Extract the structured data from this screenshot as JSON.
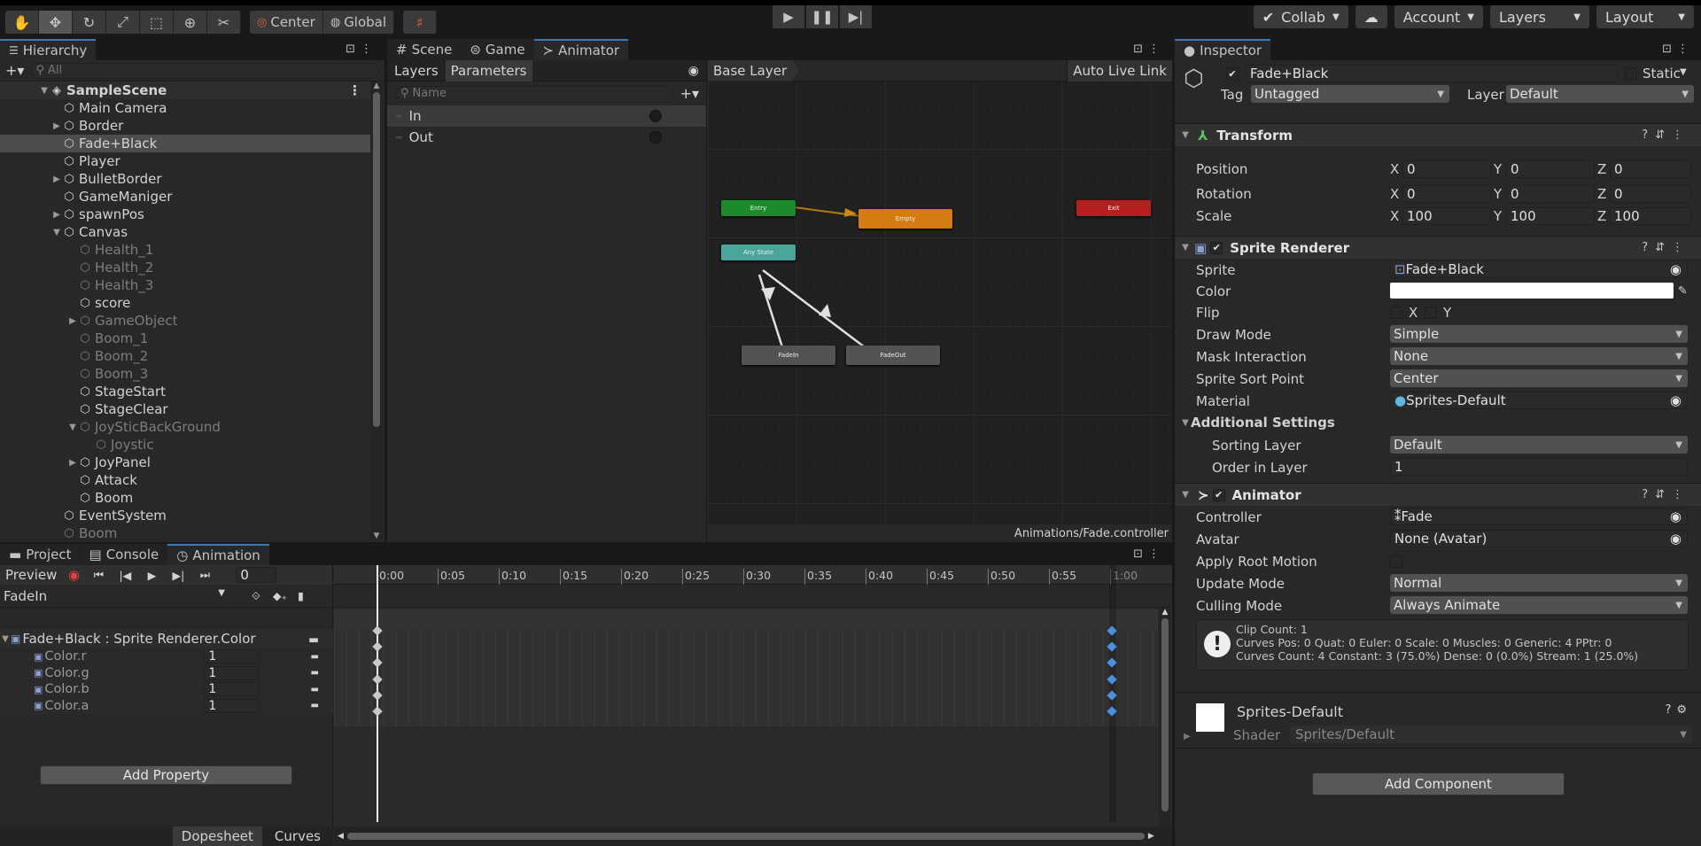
{
  "toolbar": {
    "center": "Center",
    "global": "Global",
    "collab": "Collab",
    "account": "Account",
    "layers": "Layers",
    "layout": "Layout"
  },
  "hierarchy": {
    "tab": "Hierarchy",
    "search_placeholder": "All",
    "scene": "SampleScene",
    "items": [
      {
        "name": "Main Camera",
        "indent": 1,
        "arrow": "",
        "dim": false,
        "sel": false
      },
      {
        "name": "Border",
        "indent": 1,
        "arrow": "▶",
        "dim": false,
        "sel": false
      },
      {
        "name": "Fade+Black",
        "indent": 1,
        "arrow": "",
        "dim": false,
        "sel": true
      },
      {
        "name": "Player",
        "indent": 1,
        "arrow": "",
        "dim": false,
        "sel": false
      },
      {
        "name": "BulletBorder",
        "indent": 1,
        "arrow": "▶",
        "dim": false,
        "sel": false
      },
      {
        "name": "GameManiger",
        "indent": 1,
        "arrow": "",
        "dim": false,
        "sel": false
      },
      {
        "name": "spawnPos",
        "indent": 1,
        "arrow": "▶",
        "dim": false,
        "sel": false
      },
      {
        "name": "Canvas",
        "indent": 1,
        "arrow": "▼",
        "dim": false,
        "sel": false
      },
      {
        "name": "Health_1",
        "indent": 2,
        "arrow": "",
        "dim": true,
        "sel": false
      },
      {
        "name": "Health_2",
        "indent": 2,
        "arrow": "",
        "dim": true,
        "sel": false
      },
      {
        "name": "Health_3",
        "indent": 2,
        "arrow": "",
        "dim": true,
        "sel": false
      },
      {
        "name": "score",
        "indent": 2,
        "arrow": "",
        "dim": false,
        "sel": false
      },
      {
        "name": "GameObject",
        "indent": 2,
        "arrow": "▶",
        "dim": true,
        "sel": false
      },
      {
        "name": "Boom_1",
        "indent": 2,
        "arrow": "",
        "dim": true,
        "sel": false
      },
      {
        "name": "Boom_2",
        "indent": 2,
        "arrow": "",
        "dim": true,
        "sel": false
      },
      {
        "name": "Boom_3",
        "indent": 2,
        "arrow": "",
        "dim": true,
        "sel": false
      },
      {
        "name": "StageStart",
        "indent": 2,
        "arrow": "",
        "dim": false,
        "sel": false
      },
      {
        "name": "StageClear",
        "indent": 2,
        "arrow": "",
        "dim": false,
        "sel": false
      },
      {
        "name": "JoySticBackGround",
        "indent": 2,
        "arrow": "▼",
        "dim": true,
        "sel": false
      },
      {
        "name": "Joystic",
        "indent": 3,
        "arrow": "",
        "dim": true,
        "sel": false
      },
      {
        "name": "JoyPanel",
        "indent": 2,
        "arrow": "▶",
        "dim": false,
        "sel": false
      },
      {
        "name": "Attack",
        "indent": 2,
        "arrow": "",
        "dim": false,
        "sel": false
      },
      {
        "name": "Boom",
        "indent": 2,
        "arrow": "",
        "dim": false,
        "sel": false
      },
      {
        "name": "EventSystem",
        "indent": 1,
        "arrow": "",
        "dim": false,
        "sel": false
      },
      {
        "name": "Boom",
        "indent": 1,
        "arrow": "",
        "dim": true,
        "sel": false
      }
    ]
  },
  "center_tabs": {
    "scene": "Scene",
    "game": "Game",
    "animator": "Animator"
  },
  "animator": {
    "layers_tab": "Layers",
    "params_tab": "Parameters",
    "name_placeholder": "Name",
    "params": [
      "In",
      "Out"
    ],
    "breadcrumb": "Base Layer",
    "auto_live_link": "Auto Live Link",
    "footer": "Animations/Fade.controller",
    "nodes": {
      "entry": "Entry",
      "empty": "Empty",
      "exit": "Exit",
      "any_state": "Any State",
      "fadein": "FadeIn",
      "fadeout": "FadeOut"
    }
  },
  "bottom_tabs": {
    "project": "Project",
    "console": "Console",
    "animation": "Animation"
  },
  "animation": {
    "preview": "Preview",
    "frame": "0",
    "clip": "FadeIn",
    "ticks": [
      "0:00",
      "0:05",
      "0:10",
      "0:15",
      "0:20",
      "0:25",
      "0:30",
      "0:35",
      "0:40",
      "0:45",
      "0:50",
      "0:55",
      "1:00"
    ],
    "group": "Fade+Black : Sprite Renderer.Color",
    "props": [
      {
        "name": "Color.r",
        "value": "1"
      },
      {
        "name": "Color.g",
        "value": "1"
      },
      {
        "name": "Color.b",
        "value": "1"
      },
      {
        "name": "Color.a",
        "value": "1"
      }
    ],
    "add_property": "Add Property",
    "dopesheet": "Dopesheet",
    "curves": "Curves"
  },
  "inspector": {
    "tab": "Inspector",
    "object_name": "Fade+Black",
    "static": "Static",
    "tag_label": "Tag",
    "tag": "Untagged",
    "layer_label": "Layer",
    "layer": "Default",
    "transform": {
      "title": "Transform",
      "position": "Position",
      "rotation": "Rotation",
      "scale": "Scale",
      "x": "X",
      "y": "Y",
      "z": "Z",
      "pos": [
        "0",
        "0",
        "0"
      ],
      "rot": [
        "0",
        "0",
        "0"
      ],
      "scl": [
        "100",
        "100",
        "100"
      ]
    },
    "sprite_renderer": {
      "title": "Sprite Renderer",
      "sprite_label": "Sprite",
      "sprite": "Fade+Black",
      "color_label": "Color",
      "flip_label": "Flip",
      "flip_x": "X",
      "flip_y": "Y",
      "draw_mode_label": "Draw Mode",
      "draw_mode": "Simple",
      "mask_label": "Mask Interaction",
      "mask": "None",
      "sort_point_label": "Sprite Sort Point",
      "sort_point": "Center",
      "material_label": "Material",
      "material": "Sprites-Default",
      "additional": "Additional Settings",
      "sorting_layer_label": "Sorting Layer",
      "sorting_layer": "Default",
      "order_label": "Order in Layer",
      "order": "1"
    },
    "animator_comp": {
      "title": "Animator",
      "controller_label": "Controller",
      "controller": "Fade",
      "avatar_label": "Avatar",
      "avatar": "None (Avatar)",
      "root_motion_label": "Apply Root Motion",
      "update_label": "Update Mode",
      "update": "Normal",
      "culling_label": "Culling Mode",
      "culling": "Always Animate",
      "info": [
        "Clip Count: 1",
        "Curves Pos: 0 Quat: 0 Euler: 0 Scale: 0 Muscles: 0 Generic: 4 PPtr: 0",
        "Curves Count: 4 Constant: 3 (75.0%) Dense: 0 (0.0%) Stream: 1 (25.0%)"
      ]
    },
    "material_section": {
      "name": "Sprites-Default",
      "shader_label": "Shader",
      "shader": "Sprites/Default"
    },
    "add_component": "Add Component"
  }
}
